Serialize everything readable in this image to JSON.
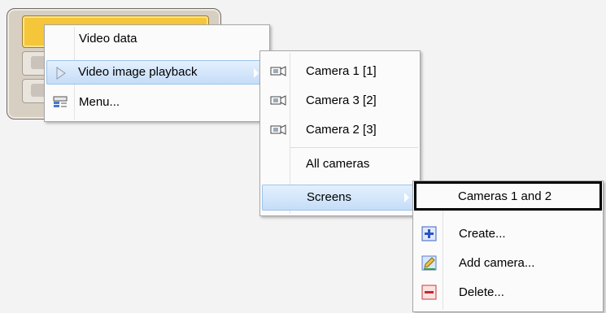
{
  "menu_main": {
    "items": [
      {
        "label": "Video data",
        "icon": null
      },
      {
        "label": "Video image playback",
        "icon": "play-icon"
      },
      {
        "label": "Menu...",
        "icon": "menu-icon"
      }
    ]
  },
  "menu_cameras": {
    "items": [
      {
        "label": "Camera 1 [1]",
        "icon": "camera-icon"
      },
      {
        "label": "Camera 3 [2]",
        "icon": "camera-icon"
      },
      {
        "label": "Camera 2 [3]",
        "icon": "camera-icon"
      },
      {
        "label": "All cameras",
        "icon": null
      },
      {
        "label": "Screens",
        "icon": null
      }
    ]
  },
  "menu_screens": {
    "items": [
      {
        "label": "Cameras 1 and 2",
        "icon": null
      },
      {
        "label": "Create...",
        "icon": "plus-icon"
      },
      {
        "label": "Add camera...",
        "icon": "edit-icon"
      },
      {
        "label": "Delete...",
        "icon": "minus-icon"
      }
    ]
  },
  "colors": {
    "highlight_top": "#e4f0fd",
    "highlight_bottom": "#c5ddf8",
    "yellow_button": "#f5c63a"
  }
}
